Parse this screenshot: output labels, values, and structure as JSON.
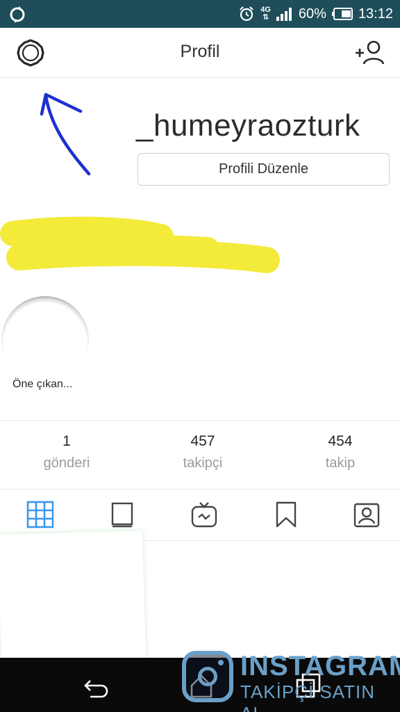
{
  "status_bar": {
    "network": "4G",
    "battery": "60%",
    "time": "13:12"
  },
  "header": {
    "title": "Profil",
    "settings_icon": "gear-icon",
    "add_user_icon": "add-user-icon"
  },
  "profile": {
    "username": "_humeyraozturk",
    "edit_button": "Profili Düzenle"
  },
  "highlight": {
    "label": "Öne çıkan..."
  },
  "stats": [
    {
      "value": "1",
      "label": "gönderi"
    },
    {
      "value": "457",
      "label": "takipçi"
    },
    {
      "value": "454",
      "label": "takip"
    }
  ],
  "tabs": [
    "grid-icon",
    "feed-icon",
    "igtv-icon",
    "saved-icon",
    "tagged-icon"
  ],
  "colors": {
    "status_bar": "#1f4e5a",
    "active_tab": "#3897f0",
    "annotation_arrow": "#1e2fd0",
    "scribble": "#f4ea3a",
    "watermark": "#6aa0c8"
  },
  "watermark": {
    "title": "INSTAGRAM",
    "subtitle": "TAKİPÇİ SATIN AL"
  }
}
